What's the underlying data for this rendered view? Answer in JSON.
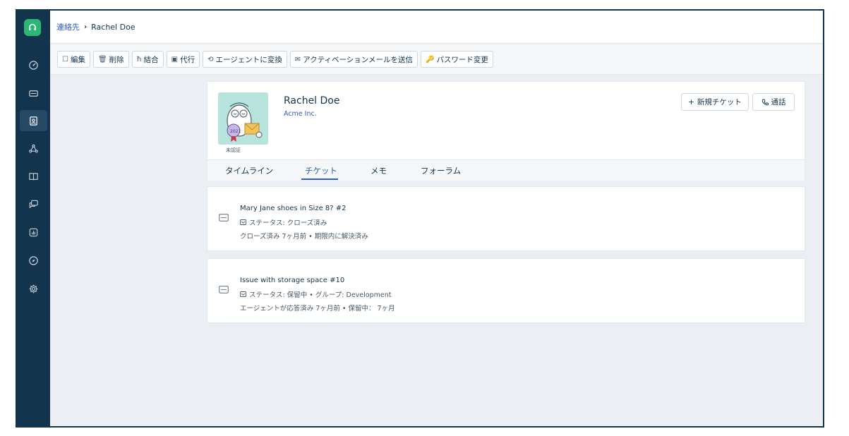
{
  "breadcrumb": {
    "link": "連絡先",
    "separator": "›",
    "current": "Rachel Doe"
  },
  "toolbar": [
    {
      "icon": "edit-icon",
      "glyph": "☐",
      "label": "編集"
    },
    {
      "icon": "trash-icon",
      "glyph": "🗑",
      "label": "削除"
    },
    {
      "icon": "merge-icon",
      "glyph": "ħ",
      "label": "結合"
    },
    {
      "icon": "impersonate-icon",
      "glyph": "▣",
      "label": "代行"
    },
    {
      "icon": "convert-icon",
      "glyph": "⟲",
      "label": "エージェントに変換"
    },
    {
      "icon": "mail-icon",
      "glyph": "✉",
      "label": "アクティベーションメールを送信"
    },
    {
      "icon": "key-icon",
      "glyph": "🔑",
      "label": "パスワード変更"
    }
  ],
  "contact": {
    "name": "Rachel Doe",
    "company": "Acme Inc.",
    "verification": "未認証"
  },
  "actions": {
    "new_ticket": "新規チケット",
    "new_ticket_prefix": "+",
    "call": "通話"
  },
  "tabs": [
    "タイムライン",
    "チケット",
    "メモ",
    "フォーラム"
  ],
  "active_tab": 1,
  "tickets": [
    {
      "title": "Mary Jane shoes in Size 8? #2",
      "status": "ステータス: クローズ済み",
      "meta": "クローズ済み 7ヶ月前 • 期限内に解決済み"
    },
    {
      "title": "Issue with storage space #10",
      "status": "ステータス: 保留中 • グループ: Development",
      "meta": "エージェントが応答済み 7ヶ月前 • 保留中： 7ヶ月"
    }
  ],
  "colors": {
    "sidebar": "#12344d",
    "brand": "#2bb673",
    "link": "#2c5cc5"
  },
  "sidebar_icons": [
    "dashboard-icon",
    "tickets-icon",
    "contacts-icon",
    "social-icon",
    "solutions-icon",
    "forums-icon",
    "reports-icon",
    "discover-icon",
    "admin-icon"
  ]
}
